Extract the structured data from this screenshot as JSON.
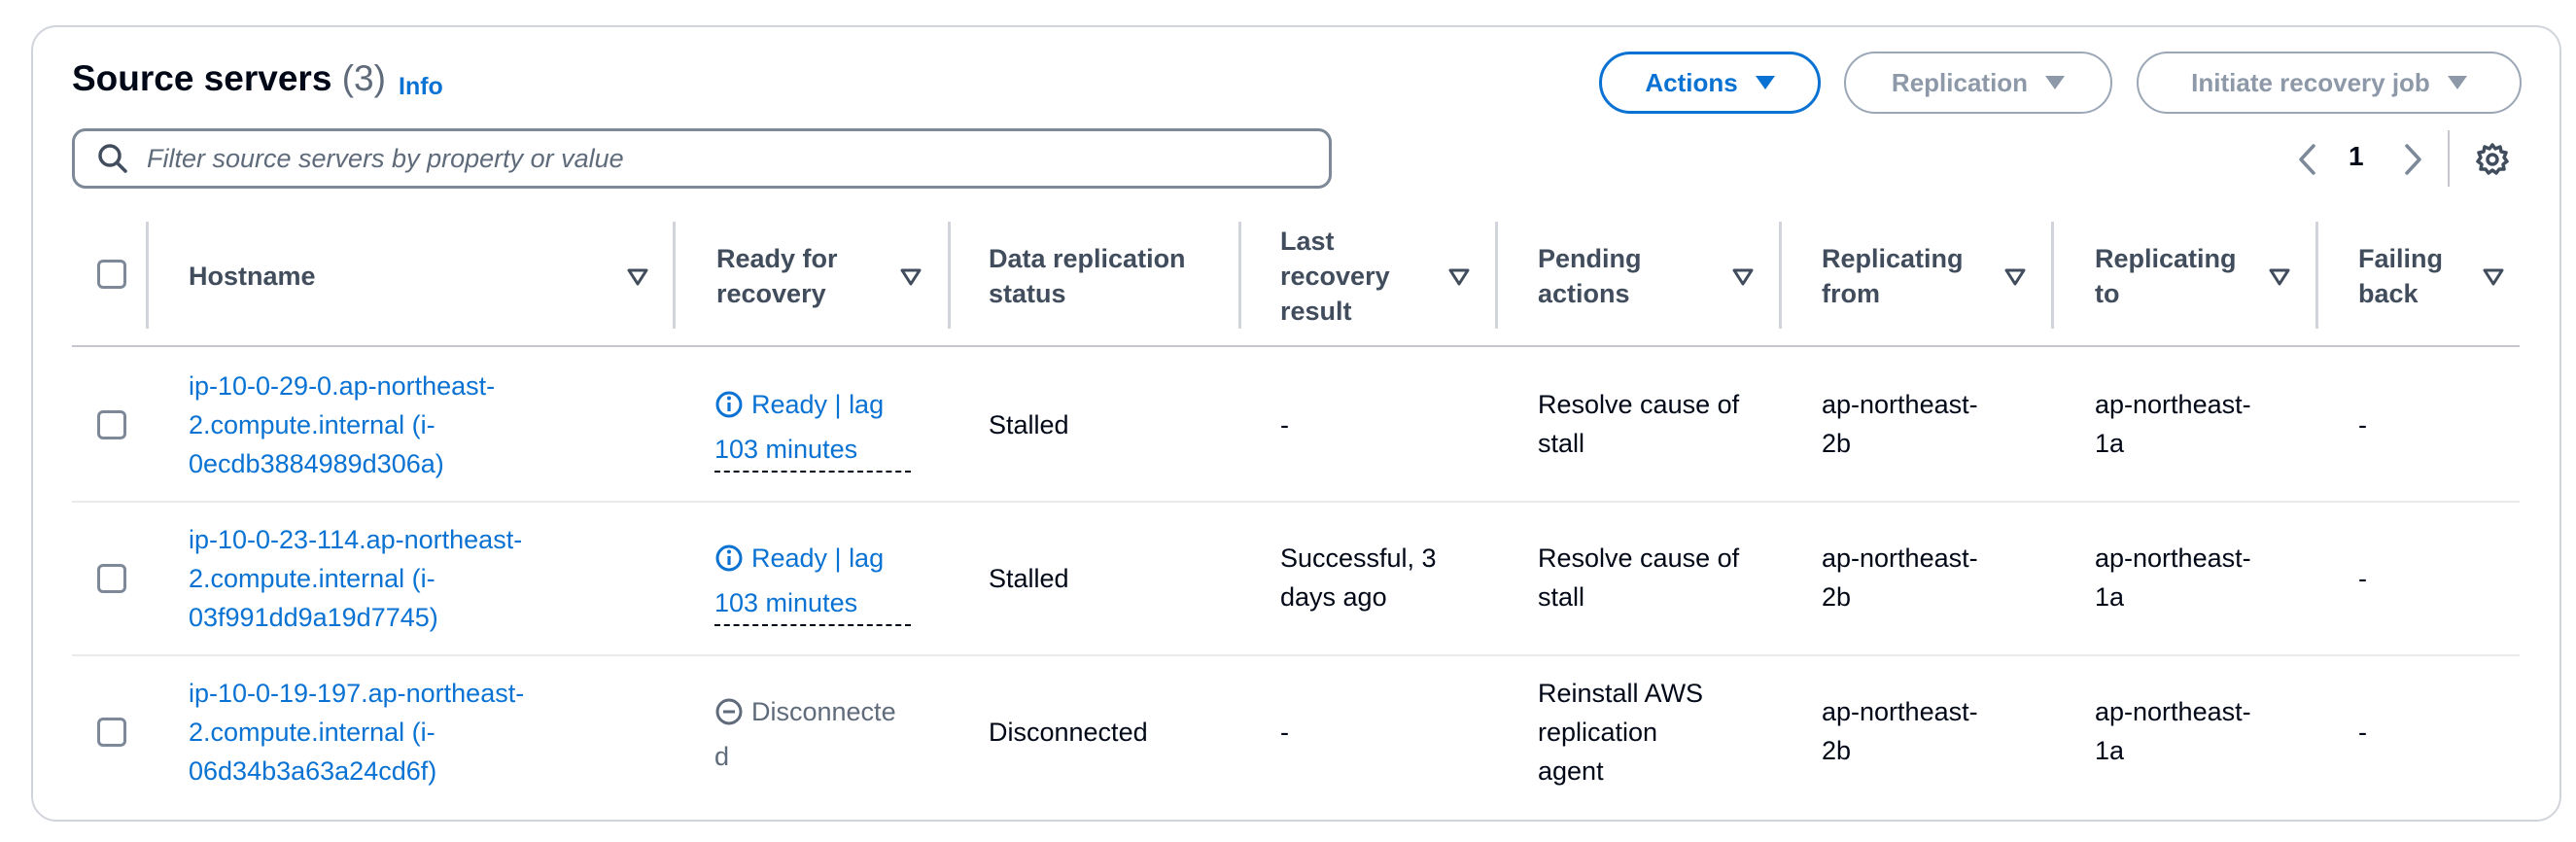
{
  "header": {
    "title": "Source servers",
    "count": "(3)",
    "info": "Info"
  },
  "buttons": {
    "actions": "Actions",
    "replication": "Replication",
    "initiate_recovery": "Initiate recovery job"
  },
  "search": {
    "placeholder": "Filter source servers by property or value"
  },
  "pagination": {
    "page": "1"
  },
  "columns": {
    "hostname": "Hostname",
    "ready_l1": "Ready for",
    "ready_l2": "recovery",
    "repl_status_l1": "Data replication",
    "repl_status_l2": "status",
    "last_l1": "Last",
    "last_l2": "recovery",
    "last_l3": "result",
    "pending_l1": "Pending",
    "pending_l2": "actions",
    "from_l1": "Replicating",
    "from_l2": "from",
    "to_l1": "Replicating",
    "to_l2": "to",
    "failing_l1": "Failing",
    "failing_l2": "back"
  },
  "rows": [
    {
      "host_l1": "ip-10-0-29-0.ap-northeast-",
      "host_l2": "2.compute.internal (i-",
      "host_l3": "0ecdb3884989d306a)",
      "ready_l1": "Ready | lag",
      "ready_l2": "103 minutes",
      "repl_status": "Stalled",
      "last_l1": "-",
      "last_l2": "",
      "pending_l1": "Resolve cause of",
      "pending_l2": "stall",
      "pending_l3": "",
      "from_l1": "ap-northeast-",
      "from_l2": "2b",
      "to_l1": "ap-northeast-",
      "to_l2": "1a",
      "failing": "-"
    },
    {
      "host_l1": "ip-10-0-23-114.ap-northeast-",
      "host_l2": "2.compute.internal (i-",
      "host_l3": "03f991dd9a19d7745)",
      "ready_l1": "Ready | lag",
      "ready_l2": "103 minutes",
      "repl_status": "Stalled",
      "last_l1": "Successful, 3",
      "last_l2": "days ago",
      "pending_l1": "Resolve cause of",
      "pending_l2": "stall",
      "pending_l3": "",
      "from_l1": "ap-northeast-",
      "from_l2": "2b",
      "to_l1": "ap-northeast-",
      "to_l2": "1a",
      "failing": "-"
    },
    {
      "host_l1": "ip-10-0-19-197.ap-northeast-",
      "host_l2": "2.compute.internal (i-",
      "host_l3": "06d34b3a63a24cd6f)",
      "ready_l1": "Disconnecte",
      "ready_l2": "d",
      "repl_status": "Disconnected",
      "last_l1": "-",
      "last_l2": "",
      "pending_l1": "Reinstall AWS",
      "pending_l2": "replication",
      "pending_l3": "agent",
      "from_l1": "ap-northeast-",
      "from_l2": "2b",
      "to_l1": "ap-northeast-",
      "to_l2": "1a",
      "failing": "-"
    }
  ],
  "colors": {
    "link": "#0972d3",
    "text": "#000716",
    "header_text": "#414d5c",
    "border": "#d1d5db"
  },
  "icons": [
    "search-icon",
    "chevron-left-icon",
    "chevron-right-icon",
    "gear-icon",
    "info-circle-icon",
    "stop-circle-icon",
    "sort-caret-icon",
    "caret-down-icon"
  ]
}
